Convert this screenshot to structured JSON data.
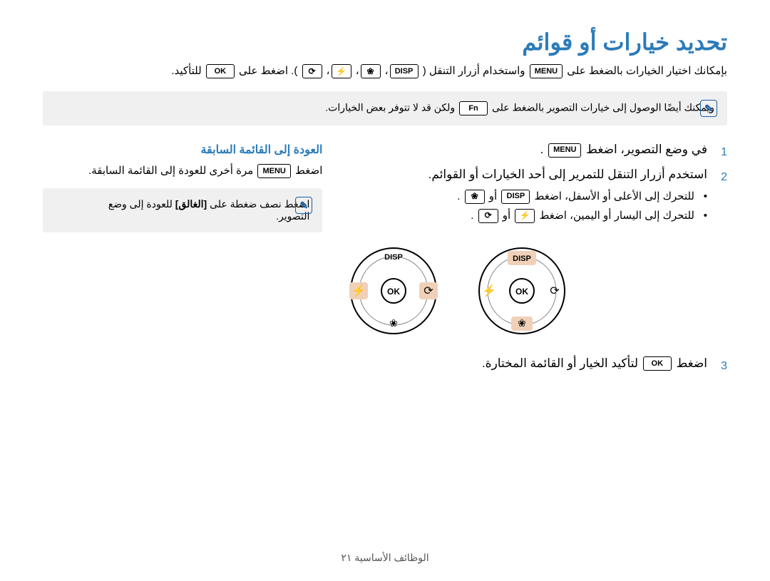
{
  "title": "تحديد خيارات أو قوائم",
  "intro_parts": {
    "p1": "بإمكانك اختيار الخيارات بالضغط على ",
    "p2": " واستخدام أزرار التنقل (",
    "p3": "). اضغط على ",
    "p4": " للتأكيد."
  },
  "keys": {
    "menu": "MENU",
    "disp": "DISP",
    "macro": "❀",
    "flash": "⚡",
    "timer": "⟳",
    "ok": "OK",
    "fn": "Fn"
  },
  "note1": {
    "p1": "ويمكنك أيضًا الوصول إلى خيارات التصوير بالضغط على ",
    "p2": " ولكن قد لا تتوفر بعض الخيارات."
  },
  "steps": {
    "s1": {
      "p1": "في وضع التصوير، اضغط ",
      "p2": "."
    },
    "s2": "استخدم أزرار التنقل للتمرير إلى أحد الخيارات أو القوائم.",
    "s2a": {
      "p1": "للتحرك إلى الأعلى أو الأسفل، اضغط ",
      "p2": " أو ",
      "p3": "."
    },
    "s2b": {
      "p1": "للتحرك إلى اليسار أو اليمين، اضغط ",
      "p2": " أو ",
      "p3": "."
    },
    "s3": {
      "p1": "اضغط ",
      "p2": " لتأكيد الخيار أو القائمة المختارة."
    }
  },
  "side": {
    "title": "العودة إلى القائمة السابقة",
    "text": {
      "p1": "اضغط ",
      "p2": " مرة أخرى للعودة إلى القائمة السابقة."
    }
  },
  "note2": {
    "p1": "اضغط نصف ضغطة على ",
    "shutter": "[الغالق]",
    "p2": " للعودة إلى وضع التصوير."
  },
  "footer": "الوظائف الأساسية  ٢١",
  "dial": {
    "disp": "DISP",
    "ok": "OK"
  }
}
